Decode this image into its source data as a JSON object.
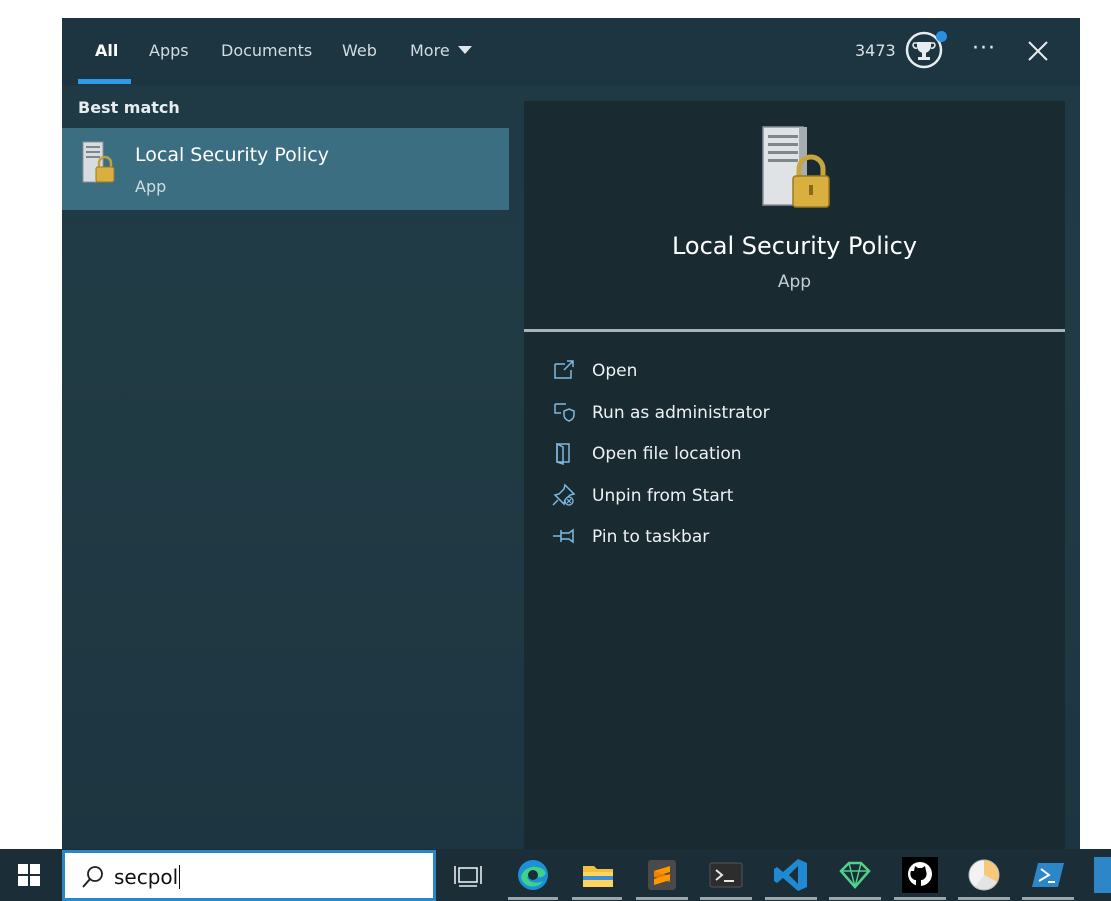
{
  "tabs": [
    {
      "label": "All",
      "active": true
    },
    {
      "label": "Apps"
    },
    {
      "label": "Documents"
    },
    {
      "label": "Web"
    },
    {
      "label": "More"
    }
  ],
  "header": {
    "points": "3473",
    "more_options_glyph": "···",
    "icons": {
      "rewards": "trophy-icon",
      "more": "ellipsis-icon",
      "close": "close-icon"
    }
  },
  "left_pane": {
    "section_label": "Best match",
    "best_match": {
      "title": "Local Security Policy",
      "subtitle": "App",
      "icon": "security-policy-icon"
    }
  },
  "detail": {
    "title": "Local Security Policy",
    "subtitle": "App",
    "actions": [
      {
        "label": "Open",
        "icon": "open-icon"
      },
      {
        "label": "Run as administrator",
        "icon": "shield-icon"
      },
      {
        "label": "Open file location",
        "icon": "folder-icon"
      },
      {
        "label": "Unpin from Start",
        "icon": "unpin-icon"
      },
      {
        "label": "Pin to taskbar",
        "icon": "pin-icon"
      }
    ]
  },
  "taskbar": {
    "search_value": "secpol",
    "apps": [
      "task-view-icon",
      "edge-icon",
      "file-explorer-icon",
      "sublime-text-icon",
      "terminal-icon",
      "vscode-icon",
      "gem-icon",
      "github-icon",
      "clock-icon",
      "powershell-icon"
    ]
  },
  "colors": {
    "accent": "#2d9be6",
    "panel_bg": "#1f3a45",
    "selected_bg": "#3b6e80",
    "detail_bg": "#1a2a31",
    "taskbar_bg": "#1b2e37"
  }
}
